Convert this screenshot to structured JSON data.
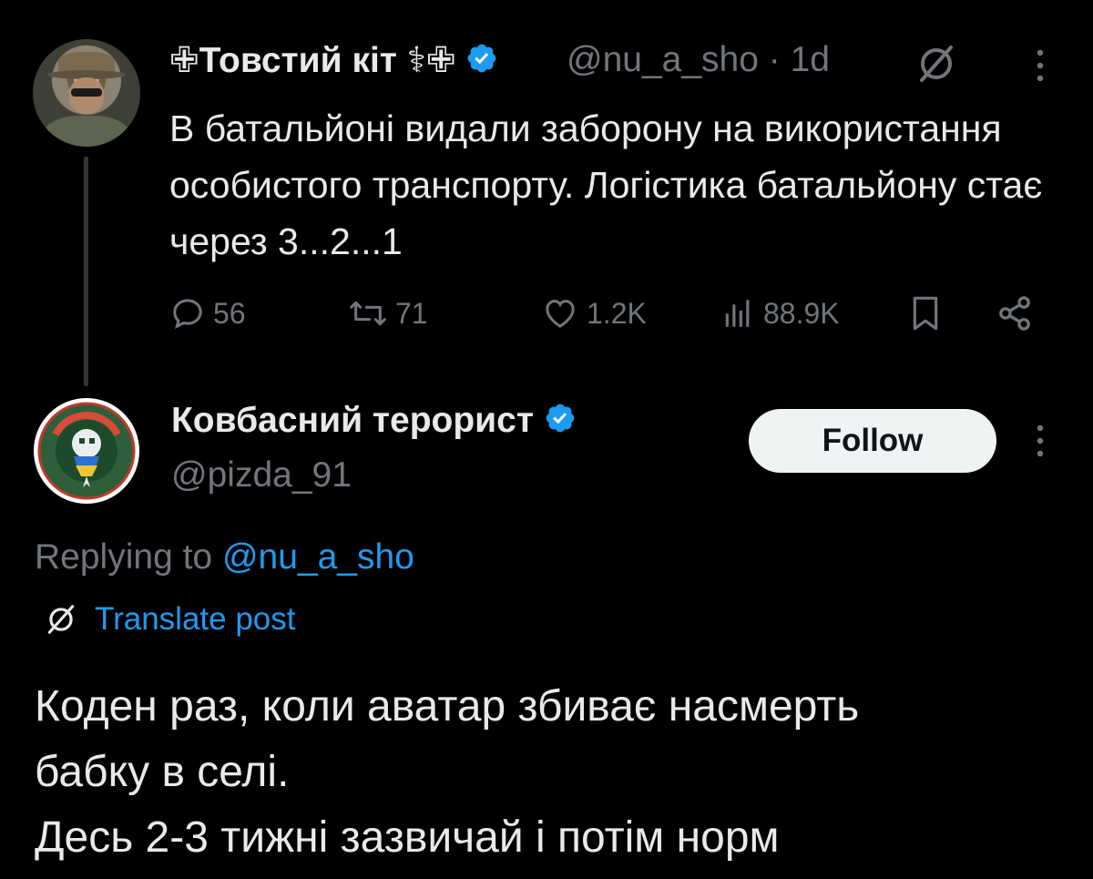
{
  "parent_tweet": {
    "author_name": "✙Товстий кіт ⚕✙",
    "handle": "@nu_a_sho",
    "separator": "·",
    "time": "1d",
    "text": "В батальйоні видали заборону на використання особистого транспорту. Логістика батальйону стає через 3...2...1",
    "actions": {
      "replies": "56",
      "reposts": "71",
      "likes": "1.2K",
      "views": "88.9K"
    },
    "icons": [
      "grok-icon",
      "more-icon",
      "reply-icon",
      "repost-icon",
      "like-icon",
      "views-icon",
      "bookmark-icon",
      "share-icon",
      "verified-badge-icon"
    ]
  },
  "reply_tweet": {
    "author_name": "Ковбасний терорист",
    "handle": "@pizda_91",
    "follow_label": "Follow",
    "replying_prefix": "Replying to ",
    "replying_handle": "@nu_a_sho",
    "translate_label": "Translate post",
    "text_lines": [
      "Коден раз, коли аватар збиває насмерть",
      "бабку в селі.",
      "Десь 2-3 тижні зазвичай і потім норм"
    ]
  },
  "colors": {
    "background": "#000000",
    "text_primary": "#e7e9ea",
    "text_secondary": "#71767b",
    "accent": "#1d9bf0",
    "follow_bg": "#eff3f4"
  }
}
